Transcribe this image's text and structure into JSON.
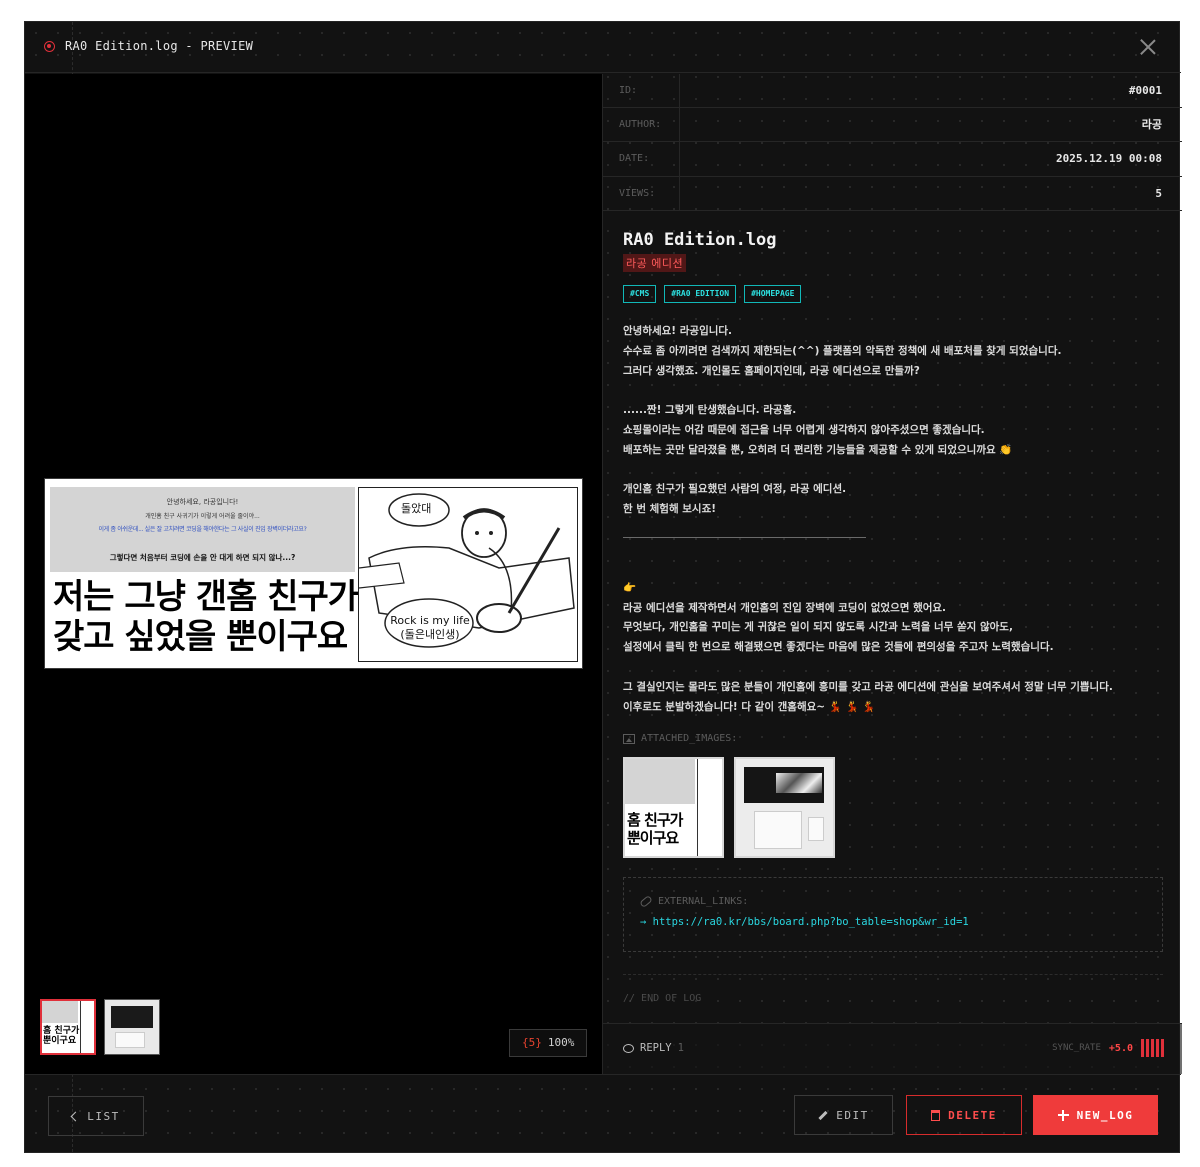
{
  "window": {
    "title": "RA0 Edition.log - PREVIEW"
  },
  "viewer": {
    "counter_index": "{5}",
    "counter_zoom": "100%",
    "image_text": {
      "greeting": "안녕하세요, 라공입니다!",
      "line2": "개인홈 친구 사귀기가 이렇게 어려울 줄이야...",
      "line3": "이게 좀 아쉬운데... 실은 잘 고치려면 코딩을 해야한다는 그 사실이 진입 장벽이더라고요?",
      "line4": "그렇다면 처음부터 코딩에 손을 안 대게 하면 되지 않나...?",
      "big_line1": "저는 그냥 갠홈 친구가",
      "big_line2": "갖고 싶었을 뿐이구요",
      "bubble_top": "돌았대",
      "bubble_bottom_1": "Rock is my life",
      "bubble_bottom_2": "(돌은내인생)"
    },
    "thumb_text": {
      "line1": "홈 친구가",
      "line2": "뿐이구요"
    }
  },
  "meta": [
    {
      "key": "ID:",
      "value": "#0001"
    },
    {
      "key": "AUTHOR:",
      "value": "라공"
    },
    {
      "key": "DATE:",
      "value": "2025.12.19 00:08"
    },
    {
      "key": "VIEWS:",
      "value": "5"
    }
  ],
  "post": {
    "title": "RA0 Edition.log",
    "subtitle": "라공 에디션",
    "tags": [
      "#CMS",
      "#RA0 EDITION",
      "#HOMEPAGE"
    ],
    "body": {
      "p1": [
        "안녕하세요! 라공입니다.",
        "수수료 좀 아끼려면 검색까지 제한되는(^^) 플랫폼의 악독한 정책에 새 배포처를 찾게 되었습니다.",
        "그러다 생각했죠. 개인몰도 홈페이지인데, 라공 에디션으로 만들까?"
      ],
      "p2": [
        "......짠! 그렇게 탄생했습니다. 라공홈.",
        "쇼핑몰이라는 어감 때문에 접근을 너무 어렵게 생각하지 않아주셨으면 좋겠습니다.",
        "배포하는 곳만 달라졌을 뿐, 오히려 더 편리한 기능들을 제공할 수 있게 되었으니까요"
      ],
      "p2_emoji": "👏",
      "p3": [
        "개인홈 친구가 필요했던 사람의 여정, 라공 에디션.",
        "한 번 체험해 보시죠!"
      ],
      "point_emoji": "👉",
      "p4": [
        "라공 에디션을 제작하면서 개인홈의 진입 장벽에 코딩이 없었으면 했어요.",
        "무엇보다, 개인홈을 꾸미는 게 귀찮은 일이 되지 않도록 시간과 노력을 너무 쏟지 않아도,",
        "설정에서 클릭 한 번으로 해결됐으면 좋겠다는 마음에 많은 것들에 편의성을 주고자 노력했습니다."
      ],
      "p5": [
        "그 결실인지는 몰라도 많은 분들이 개인홈에 흥미를 갖고 라공 에디션에 관심을 보여주셔서 정말 너무 기쁩니다.",
        "이후로도 분발하겠습니다! 다 같이 갠홈해요~"
      ],
      "p5_emoji": "💃 💃 💃"
    },
    "attached_label": "ATTACHED_IMAGES:",
    "external_label": "EXTERNAL_LINKS:",
    "external_url": "→ https://ra0.kr/bbs/board.php?bo_table=shop&wr_id=1",
    "end_label": "// END OF LOG"
  },
  "reply": {
    "label": "REPLY",
    "count": "1"
  },
  "sync": {
    "label": "SYNC_RATE",
    "value": "+5.0",
    "bar_count": 5
  },
  "footer": {
    "list": "LIST",
    "edit": "EDIT",
    "delete": "DELETE",
    "new_log": "NEW_LOG"
  },
  "colors": {
    "accent_red": "#ef3b3b",
    "accent_cyan": "#2de0e0",
    "background": "#121212"
  }
}
